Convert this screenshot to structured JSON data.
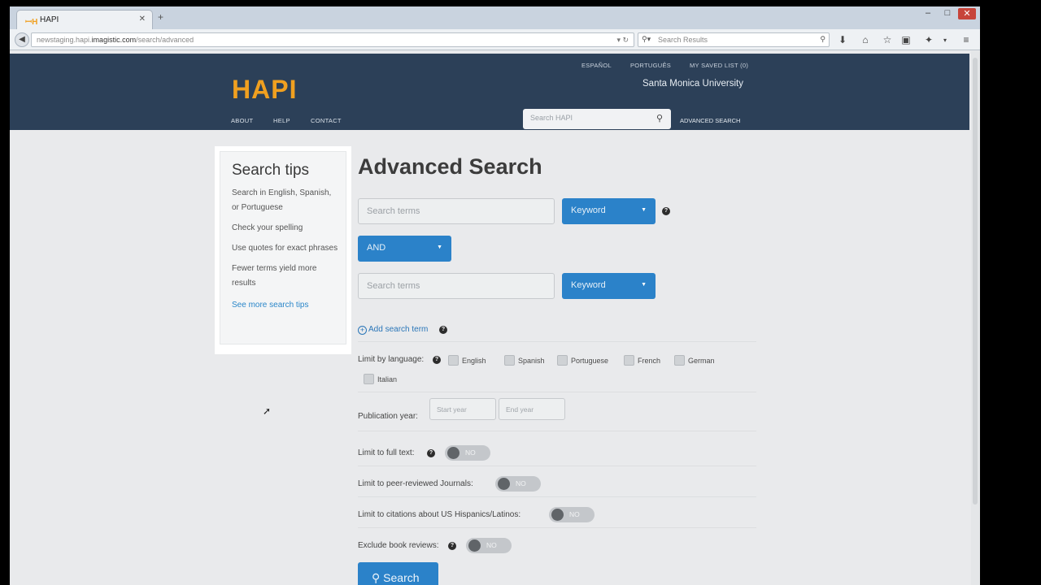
{
  "browser": {
    "tab_title": "HAPI",
    "tab_favicon": "HAPI",
    "url_prefix": "newstaging.hapi.",
    "url_domain": "imagistic.com",
    "url_path": "/search/advanced",
    "search_placeholder": "Search Results"
  },
  "header": {
    "lang_es": "ESPAÑOL",
    "lang_pt": "PORTUGUÊS",
    "saved_list": "MY SAVED LIST (0)",
    "institution": "Santa Monica University",
    "logo": "HAPI",
    "nav_about": "ABOUT",
    "nav_help": "HELP",
    "nav_contact": "CONTACT",
    "search_placeholder": "Search HAPI",
    "advanced_link": "ADVANCED SEARCH"
  },
  "tips": {
    "title": "Search tips",
    "items": [
      "Search in English, Spanish, or Portuguese",
      "Check your spelling",
      "Use quotes for exact phrases",
      "Fewer terms yield more results"
    ],
    "more_link": "See more search tips"
  },
  "form": {
    "title": "Advanced Search",
    "term1_placeholder": "Search terms",
    "field1": "Keyword",
    "operator": "AND",
    "term2_placeholder": "Search terms",
    "field2": "Keyword",
    "add_term": "Add search term",
    "language_label": "Limit by language:",
    "languages": [
      "English",
      "Spanish",
      "Portuguese",
      "French",
      "German",
      "Italian"
    ],
    "pubyear_label": "Publication year:",
    "start_year_placeholder": "Start year",
    "end_year_placeholder": "End year",
    "fulltext_label": "Limit to full text:",
    "peer_label": "Limit to peer-reviewed Journals:",
    "hispanic_label": "Limit to citations about US Hispanics/Latinos:",
    "bookreview_label": "Exclude book reviews:",
    "toggle_value": "NO",
    "search_button": "Search"
  },
  "colors": {
    "header_bg": "#2c4058",
    "accent_blue": "#2b82c9",
    "logo_orange": "#f0a020"
  }
}
